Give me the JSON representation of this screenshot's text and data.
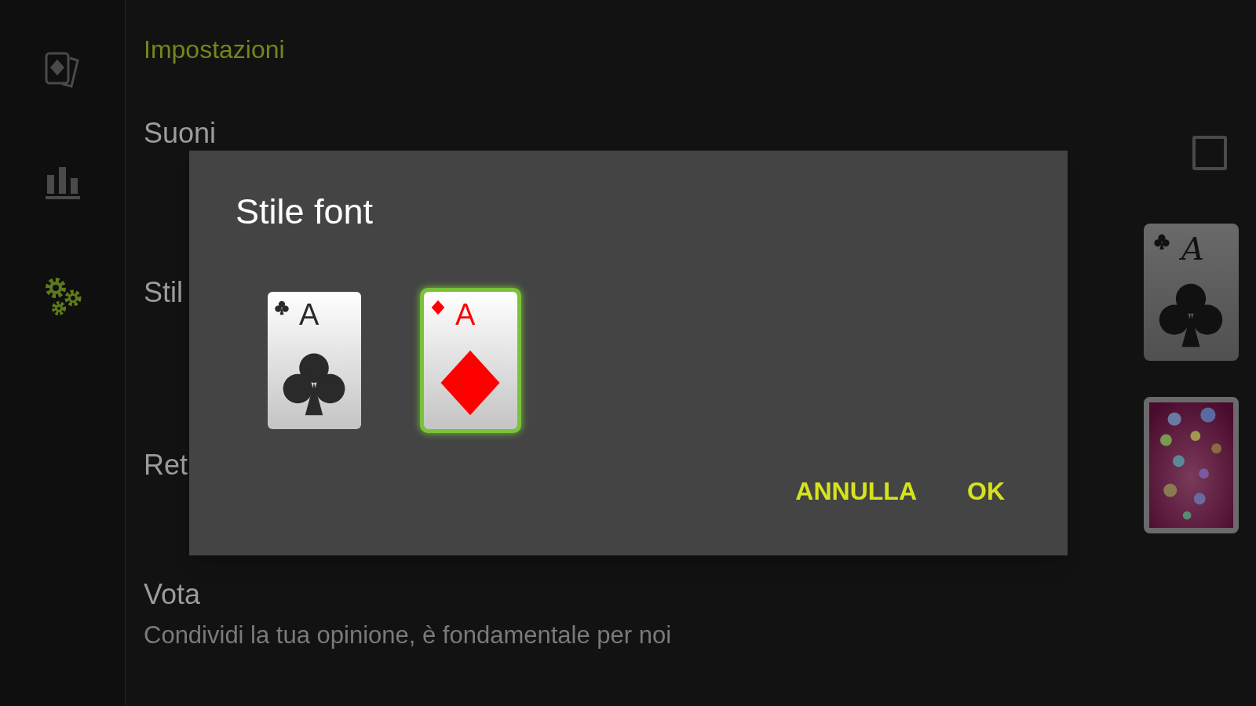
{
  "sidebar": {
    "items": [
      {
        "kind": "cards",
        "selected": false
      },
      {
        "kind": "stats",
        "selected": false
      },
      {
        "kind": "settings",
        "selected": true
      }
    ]
  },
  "header": {
    "title": "Impostazioni"
  },
  "settings": [
    {
      "kind": "checkbox",
      "title": "Suoni",
      "checked": false
    },
    {
      "kind": "card_face",
      "title": "Stil",
      "card": {
        "rank": "A",
        "kind": "clubs"
      }
    },
    {
      "kind": "card_back",
      "title": "Ret"
    },
    {
      "kind": "text",
      "title": "Vota",
      "subtitle": "Condividi la tua opinione, è fondamentale per noi"
    }
  ],
  "dialog": {
    "title": "Stile font",
    "options": [
      {
        "rank": "A",
        "kind": "clubs",
        "selected": false
      },
      {
        "rank": "A",
        "kind": "diamonds",
        "selected": true
      }
    ],
    "buttons": [
      "ANNULLA",
      "OK"
    ]
  }
}
